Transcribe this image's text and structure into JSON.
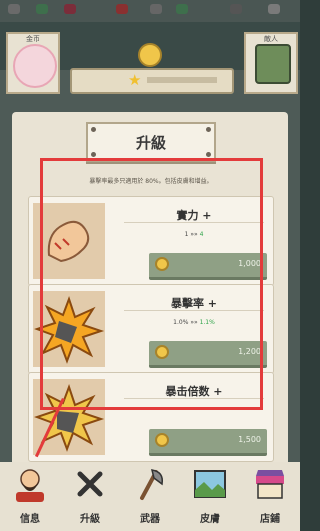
{
  "top": {
    "left_portrait_label": "金币",
    "right_portrait_label": "敵人"
  },
  "panel": {
    "title": "升級",
    "note": "暴擊率最多只適用於 80%。包括皮膚和增益。"
  },
  "cards": [
    {
      "name": "實力 +",
      "level_current": "1",
      "level_next": "4",
      "price": "1,000",
      "icon": "muscle-arm"
    },
    {
      "name": "暴擊率 +",
      "level_current": "1.0%",
      "level_next": "1.1%",
      "price": "1,200",
      "icon": "explosion"
    },
    {
      "name": "暴击倍数 +",
      "level_current": "",
      "level_next": "",
      "price": "1,500",
      "icon": "explosion-gold"
    }
  ],
  "nav": [
    {
      "label": "信息",
      "icon": "bearded-warrior"
    },
    {
      "label": "升級",
      "icon": "crossed-x"
    },
    {
      "label": "武器",
      "icon": "axe"
    },
    {
      "label": "皮膚",
      "icon": "landscape-picture"
    },
    {
      "label": "店鋪",
      "icon": "shop-awning"
    }
  ],
  "colors": {
    "highlight": "#e33b3b",
    "button": "#8fa085",
    "coin": "#f0c64a",
    "upgrade_value": "#2fa44a"
  }
}
